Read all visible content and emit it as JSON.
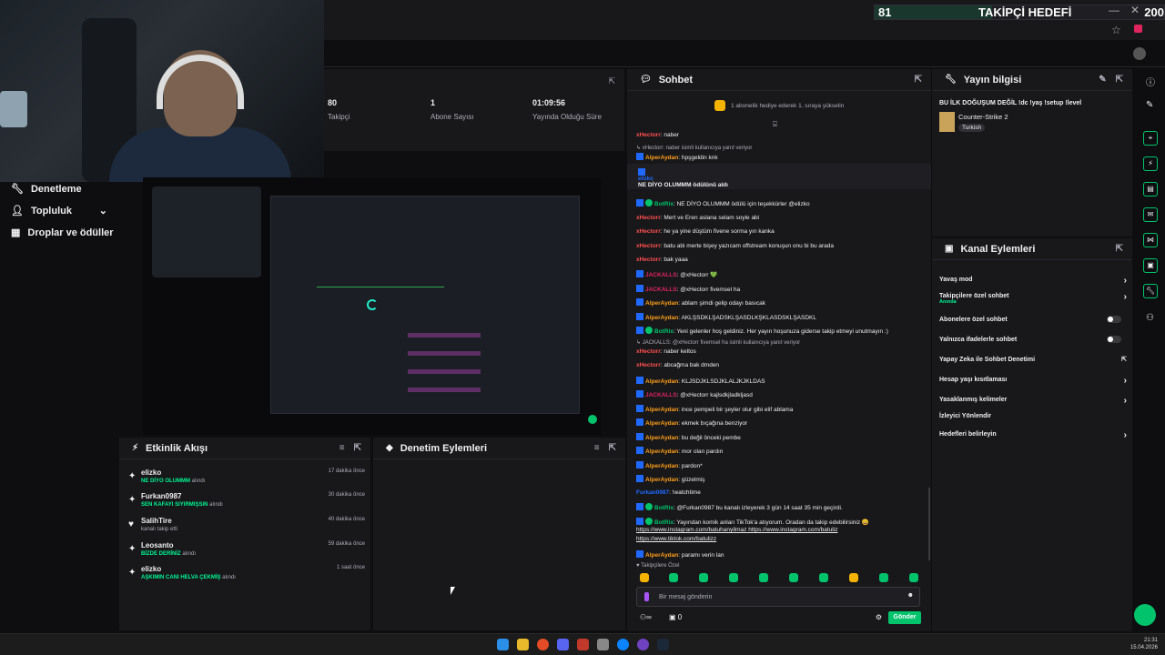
{
  "goal": {
    "current": "81",
    "title": "TAKİPÇİ HEDEFİ",
    "target": "200",
    "progress": 0.405
  },
  "window": {
    "minimize": "—",
    "close": "✕",
    "star": "☆"
  },
  "nav": {
    "items": [
      {
        "label": "Denetleme",
        "icon": "wrench-icon"
      },
      {
        "label": "Topluluk",
        "icon": "community-icon"
      },
      {
        "label": "Droplar ve ödüller",
        "icon": "drops-icon"
      }
    ]
  },
  "stats": [
    {
      "value": "80",
      "label": "Takipçi"
    },
    {
      "value": "1",
      "label": "Abone Sayısı"
    },
    {
      "value": "01:09:56",
      "label": "Yayında Olduğu Süre"
    }
  ],
  "activity": {
    "title": "Etkinlik Akışı",
    "items": [
      {
        "user": "elizko",
        "reward": "NE DİYO OLUMMM",
        "suffix": "alındı",
        "time": "17 dakika önce",
        "icon": "reward-icon"
      },
      {
        "user": "Furkan0987",
        "reward": "SEN KAFAYI SIYIRMIŞSIN",
        "suffix": "alındı",
        "time": "30 dakika önce",
        "icon": "reward-icon"
      },
      {
        "user": "SalihTire",
        "reward": "",
        "suffix": "kanalı takip etti",
        "time": "40 dakika önce",
        "icon": "heart-icon"
      },
      {
        "user": "Leosanto",
        "reward": "BİZDE DERİNİZ",
        "suffix": "alındı",
        "time": "59 dakika önce",
        "icon": "reward-icon"
      },
      {
        "user": "elizko",
        "reward": "AŞKIMIN CANI HELVA ÇEKMİŞ",
        "suffix": "alındı",
        "time": "1 saat önce",
        "icon": "reward-icon"
      }
    ]
  },
  "moderation": {
    "title": "Denetim Eylemleri"
  },
  "chat": {
    "title": "Sohbet",
    "banner": "1 abonelik hediye ederek 1. sıraya yükselin",
    "subs_only": "Takipçilere Özel",
    "placeholder": "Bir mesaj gönderin",
    "send": "Gönder",
    "footer_count": "0",
    "messages": [
      {
        "user": "xHectorr",
        "color": "#ff4f4f",
        "text": "naber",
        "badge": "none"
      },
      {
        "reply": "xHectorr: naber isimli kullanıcıya yanıt veriyor"
      },
      {
        "user": "AlperAydan",
        "color": "#ff9f1a",
        "text": "hpşgeldin knk",
        "badge": "blue"
      },
      {
        "user": "elizko",
        "color": "#1f69ff",
        "text": "NE DİYO OLUMMM ödülünü aldı",
        "badge": "reward"
      },
      {
        "user": "BotRix",
        "color": "#00c36b",
        "text": "NE DİYO OLUMMM ödülü için teşekkürler @elizko",
        "badge": "bot"
      },
      {
        "user": "xHectorr",
        "color": "#ff4f4f",
        "text": "Mert ve Eren aslana selam soyle abi",
        "badge": "none"
      },
      {
        "user": "xHectorr",
        "color": "#ff4f4f",
        "text": "he ya yine düştüm fivene sorma yın kanka",
        "badge": "none"
      },
      {
        "user": "xHectorr",
        "color": "#ff4f4f",
        "text": "batu abi merte bişey yazıcam offstream konuşun onu bi bu arada",
        "badge": "none"
      },
      {
        "user": "xHectorr",
        "color": "#ff4f4f",
        "text": "bak yaaa",
        "badge": "none"
      },
      {
        "user": "JACKALLS",
        "color": "#e0245e",
        "text": "@xHectorr 💚",
        "badge": "blue"
      },
      {
        "user": "JACKALLS",
        "color": "#e0245e",
        "text": "@xHectorr fivemsel ha",
        "badge": "blue"
      },
      {
        "user": "AlperAydan",
        "color": "#ff9f1a",
        "text": "ablam şimdi gelip odayı basıcak",
        "badge": "blue"
      },
      {
        "user": "AlperAydan",
        "color": "#ff9f1a",
        "text": "AKLŞSDKLŞADSKLŞASDLKŞKLASDSKLŞASDKL",
        "badge": "blue"
      },
      {
        "user": "BotRix",
        "color": "#00c36b",
        "text": "Yeni gelenler hoş geldiniz. Her yayın hoşunuza giderse takip etmeyi unutmayın :)",
        "badge": "bot"
      },
      {
        "reply": "JACKALLS: @xHectorr fivemsel ha isimli kullanıcıya yanıt veriyor"
      },
      {
        "user": "xHectorr",
        "color": "#ff4f4f",
        "text": "naber keltos",
        "badge": "none"
      },
      {
        "user": "xHectorr",
        "color": "#ff4f4f",
        "text": "abcağma bak dmden",
        "badge": "none"
      },
      {
        "user": "AlperAydan",
        "color": "#ff9f1a",
        "text": "KLJSDJKLSDJKLALJKJKLDAS",
        "badge": "blue"
      },
      {
        "user": "JACKALLS",
        "color": "#e0245e",
        "text": "@xHectorr kajlsdkjladkljasd",
        "badge": "blue"
      },
      {
        "user": "AlperAydan",
        "color": "#ff9f1a",
        "text": "ince pempeli bir şeyler olur gibi elif ablama",
        "badge": "blue"
      },
      {
        "user": "AlperAydan",
        "color": "#ff9f1a",
        "text": "ekmek bıçağına benziyor",
        "badge": "blue"
      },
      {
        "user": "AlperAydan",
        "color": "#ff9f1a",
        "text": "bu değil önceki pembe",
        "badge": "blue"
      },
      {
        "user": "AlperAydan",
        "color": "#ff9f1a",
        "text": "mor olan pardın",
        "badge": "blue"
      },
      {
        "user": "AlperAydan",
        "color": "#ff9f1a",
        "text": "pardon*",
        "badge": "blue"
      },
      {
        "user": "AlperAydan",
        "color": "#ff9f1a",
        "text": "güzelmiş",
        "badge": "blue"
      },
      {
        "user": "Furkan0987",
        "color": "#1f69ff",
        "text": "!watchtime",
        "badge": "none"
      },
      {
        "user": "BotRix",
        "color": "#00c36b",
        "text": "@Furkan0987 bu kanalı izleyerek 3 gün 14 saat 35 min geçirdi.",
        "badge": "bot"
      },
      {
        "user": "BotRix",
        "color": "#00c36b",
        "text": "Yayından komik anları TikTok'a atıyorum. Oradan da takip edebilirsiniz 😄",
        "badge": "bot"
      },
      {
        "link": "https://www.instagram.com/batuhanyilmaz https://www.instagram.com/batuliz"
      },
      {
        "link": "https://www.tiktok.com/batulizz"
      },
      {
        "user": "AlperAydan",
        "color": "#ff9f1a",
        "text": "paramı verin lan",
        "badge": "blue"
      }
    ]
  },
  "stream_info": {
    "title": "Yayın bilgisi",
    "stream_title": "BU İLK DOĞUŞUM DEĞİL !dc !yaş !setup !level",
    "category": "Counter-Strike 2",
    "language": "Turkish"
  },
  "channel_actions": {
    "title": "Kanal Eylemleri",
    "items": [
      {
        "label": "Yavaş mod",
        "control": "chevron"
      },
      {
        "label": "Takipçilere özel sohbet",
        "sub": "Anında",
        "control": "chevron"
      },
      {
        "label": "Abonelere özel sohbet",
        "control": "toggle"
      },
      {
        "label": "Yalnızca ifadelerle sohbet",
        "control": "toggle"
      },
      {
        "label": "Yapay Zeka ile Sohbet Denetimi",
        "control": "external"
      },
      {
        "label": "Hesap yaşı kısıtlaması",
        "control": "chevron"
      },
      {
        "label": "Yasaklanmış kelimeler",
        "control": "chevron"
      },
      {
        "label": "İzleyici Yönlendir",
        "control": "none"
      },
      {
        "label": "Hedefleri belirleyin",
        "control": "chevron"
      }
    ]
  },
  "taskbar": {
    "time": "21:31",
    "date": "15.04.2026"
  },
  "colors": {
    "accent": "#00c36b",
    "bg": "#0e0e10",
    "panel": "#18181b"
  }
}
